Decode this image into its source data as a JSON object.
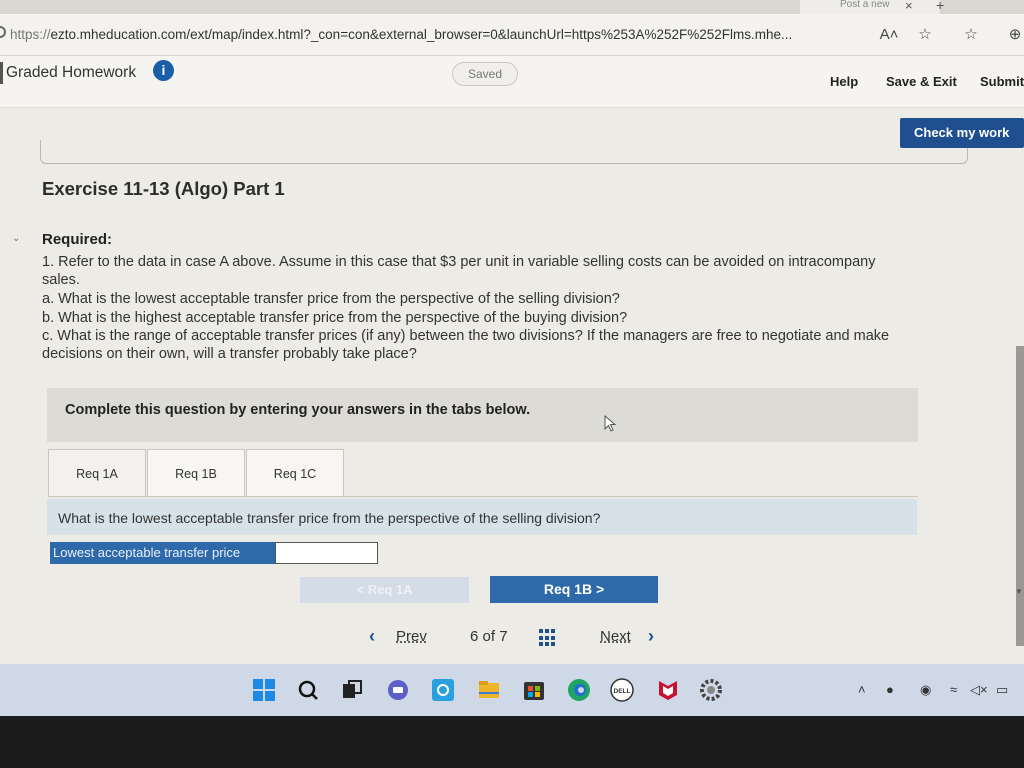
{
  "browser": {
    "tab_title": "Post a new",
    "url_proto": "https://",
    "url_rest": "ezto.mheducation.com/ext/map/index.html?_con=con&external_browser=0&launchUrl=https%253A%252F%252Flms.mhe...",
    "icons": [
      "read-aloud-icon",
      "favorite-icon",
      "favorites-list-icon",
      "add-collection-icon"
    ],
    "read_aloud_glyph": "A˄"
  },
  "header": {
    "title": "Graded Homework",
    "info_glyph": "i",
    "saved_label": "Saved",
    "help_label": "Help",
    "save_exit_label": "Save & Exit",
    "submit_label": "Submit"
  },
  "check_button": "Check my work",
  "exercise": {
    "title": "Exercise 11-13 (Algo) Part 1",
    "required_heading": "Required:",
    "lines": [
      "1. Refer to the data in case A above. Assume in this case that $3 per unit in variable selling costs can be avoided on intracompany",
      "sales.",
      "a. What is the lowest acceptable transfer price from the perspective of the selling division?",
      "b. What is the highest acceptable transfer price from the perspective of the buying division?",
      "c. What is the range of acceptable transfer prices (if any) between the two divisions? If the managers are free to negotiate and make",
      "decisions on their own, will a transfer probably take place?"
    ]
  },
  "instructions": "Complete this question by entering your answers in the tabs below.",
  "tabs": [
    {
      "label": "Req 1A"
    },
    {
      "label": "Req 1B"
    },
    {
      "label": "Req 1C"
    }
  ],
  "question": "What is the lowest acceptable transfer price from the perspective of the selling division?",
  "answer": {
    "label": "Lowest acceptable transfer price",
    "value": ""
  },
  "req_nav": {
    "prev_label": "< Req 1A",
    "next_label": "Req 1B  >"
  },
  "pager": {
    "prev_label": "Prev",
    "current": "6",
    "of_label": "of",
    "total": "7",
    "next_label": "Next"
  },
  "taskbar": {
    "icons": [
      "windows-start-icon",
      "search-icon",
      "task-view-icon",
      "teams-chat-icon",
      "office-icon",
      "file-explorer-icon",
      "store-icon",
      "edge-icon",
      "dell-icon",
      "mcafee-icon",
      "settings-icon"
    ],
    "dell_text": "DELL"
  },
  "colors": {
    "accent": "#2e6aa9",
    "check_btn": "#1f4f8e",
    "question_bg": "#d6e2e8"
  }
}
